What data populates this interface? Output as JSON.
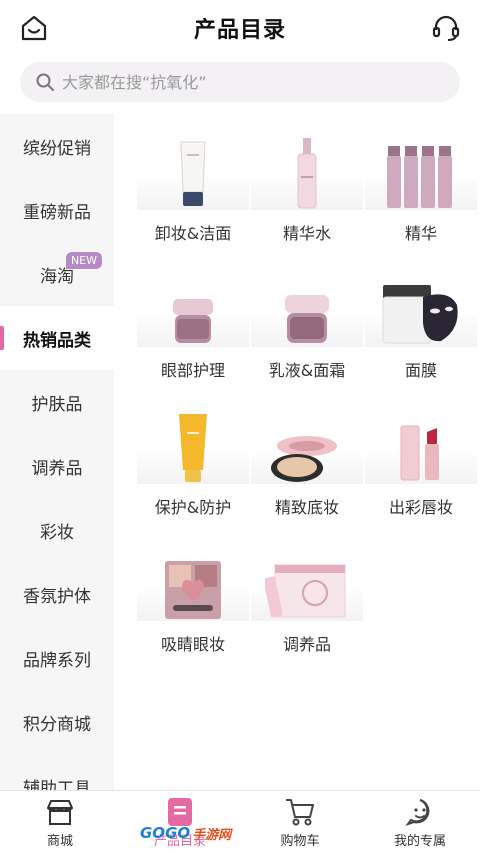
{
  "header": {
    "title": "产品目录",
    "home_icon": "home-icon",
    "support_icon": "headset-icon"
  },
  "search": {
    "placeholder": "大家都在搜“抗氧化”",
    "icon": "search-icon"
  },
  "sidebar": {
    "items": [
      {
        "label": "缤纷促销"
      },
      {
        "label": "重磅新品"
      },
      {
        "label": "海淘",
        "badge": "NEW"
      },
      {
        "label": "热销品类",
        "active": true
      },
      {
        "label": "护肤品"
      },
      {
        "label": "调养品"
      },
      {
        "label": "彩妆"
      },
      {
        "label": "香氛护体"
      },
      {
        "label": "品牌系列"
      },
      {
        "label": "积分商城"
      },
      {
        "label": "辅助工具"
      }
    ]
  },
  "categories": [
    {
      "label": "卸妆&洁面",
      "image": "cleanser-tube"
    },
    {
      "label": "精华水",
      "image": "toner-bottle"
    },
    {
      "label": "精华",
      "image": "serum-bottles"
    },
    {
      "label": "眼部护理",
      "image": "eye-cream-jar"
    },
    {
      "label": "乳液&面霜",
      "image": "face-cream-jar"
    },
    {
      "label": "面膜",
      "image": "face-mask"
    },
    {
      "label": "保护&防护",
      "image": "sunscreen-tube"
    },
    {
      "label": "精致底妆",
      "image": "cushion-compact"
    },
    {
      "label": "出彩唇妆",
      "image": "lipstick"
    },
    {
      "label": "吸睛眼妆",
      "image": "eyeshadow-palette"
    },
    {
      "label": "调养品",
      "image": "supplement-box"
    }
  ],
  "bottom_nav": [
    {
      "label": "商城",
      "icon": "store-icon"
    },
    {
      "label": "产品目录",
      "icon": "catalog-icon",
      "active": true
    },
    {
      "label": "购物车",
      "icon": "cart-icon"
    },
    {
      "label": "我的专属",
      "icon": "profile-icon"
    }
  ],
  "watermark": {
    "brand": "GOGO",
    "suffix": "手游网"
  },
  "colors": {
    "accent": "#e36aa2",
    "badge": "#b58bc6",
    "sidebar_bg": "#f6f6f6",
    "search_bg": "#f3f1f4"
  }
}
